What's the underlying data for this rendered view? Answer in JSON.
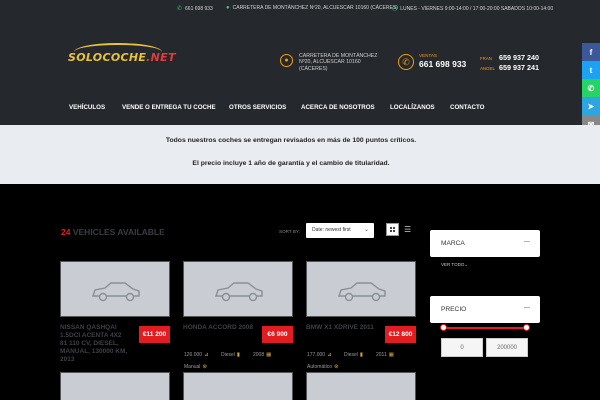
{
  "topbar": {
    "phone": "661 698 933",
    "address": "CARRETERA DE MONTÁNCHEZ Nº20, ALCUESCAR 10160 (CÁCERES)",
    "hours": "LUNES - VIERNES 9:00-14:00 / 17:00-20:00 SABADOS 10:00-14:00"
  },
  "header": {
    "logo_part1": "SOLOCOCHE",
    "logo_part2": ".NET",
    "address_lines": [
      "CARRETERA DE MONTÁNCHEZ",
      "Nº20, ALCUESCAR 10160",
      "(CÁCERES)"
    ],
    "sales_label": "VENTAS",
    "sales_phone": "661 698 933",
    "contacts": [
      {
        "name": "FRAN",
        "phone": "659 937 240"
      },
      {
        "name": "ANGEL",
        "phone": "659 937 241"
      }
    ]
  },
  "nav": {
    "items": [
      "VEHÍCULOS",
      "VENDE O ENTREGA TU COCHE",
      "OTROS SERVICIOS",
      "ACERCA DE NOSOTROS",
      "LOCALÍZANOS",
      "CONTACTO"
    ]
  },
  "social": [
    {
      "icon": "facebook-icon",
      "glyph": "f",
      "color": "#3b5998"
    },
    {
      "icon": "twitter-icon",
      "glyph": "t",
      "color": "#1da1f2"
    },
    {
      "icon": "whatsapp-icon",
      "glyph": "✆",
      "color": "#25d366"
    },
    {
      "icon": "telegram-icon",
      "glyph": "➤",
      "color": "#2ca5e0"
    },
    {
      "icon": "email-icon",
      "glyph": "✉",
      "color": "#888888"
    },
    {
      "icon": "link-icon",
      "glyph": "∞",
      "color": "#a0a0a0"
    },
    {
      "icon": "share-icon",
      "glyph": "+",
      "color": "#0166ff"
    }
  ],
  "banner": {
    "line1": "Todos nuestros coches se entregan revisados en más de 100 puntos críticos.",
    "line2": "El precio incluye 1 año de garantía y el cambio de titularidad."
  },
  "listing": {
    "count": "24",
    "count_label": "VEHICLES AVAILABLE",
    "sort_label": "SORT BY:",
    "sort_value": "Date: newest first"
  },
  "vehicles": [
    {
      "title": "NISSAN QASHQAI 1.5DCI ACENTA 4X2 81 110 CV, DIESEL, MANUAL, 130000 KM, 2013",
      "price": "€11 200"
    },
    {
      "title": "HONDA ACCORD 2008",
      "price": "€6 900",
      "km": "126.000",
      "fuel": "Diesel",
      "year": "2008",
      "transmission": "Manual"
    },
    {
      "title": "BMW X1 XDRIVE 2011",
      "price": "€12 800",
      "km": "177.000",
      "fuel": "Diesel",
      "year": "2011",
      "transmission": "Automático"
    }
  ],
  "filters": {
    "brand_label": "MARCA",
    "see_all": "VER TODO",
    "price_label": "PRECIO",
    "price_min": "0",
    "price_max": "200000"
  },
  "colors": {
    "accent_red": "#e11d22",
    "accent_orange": "#f39c12",
    "header_bg": "#25282d"
  }
}
